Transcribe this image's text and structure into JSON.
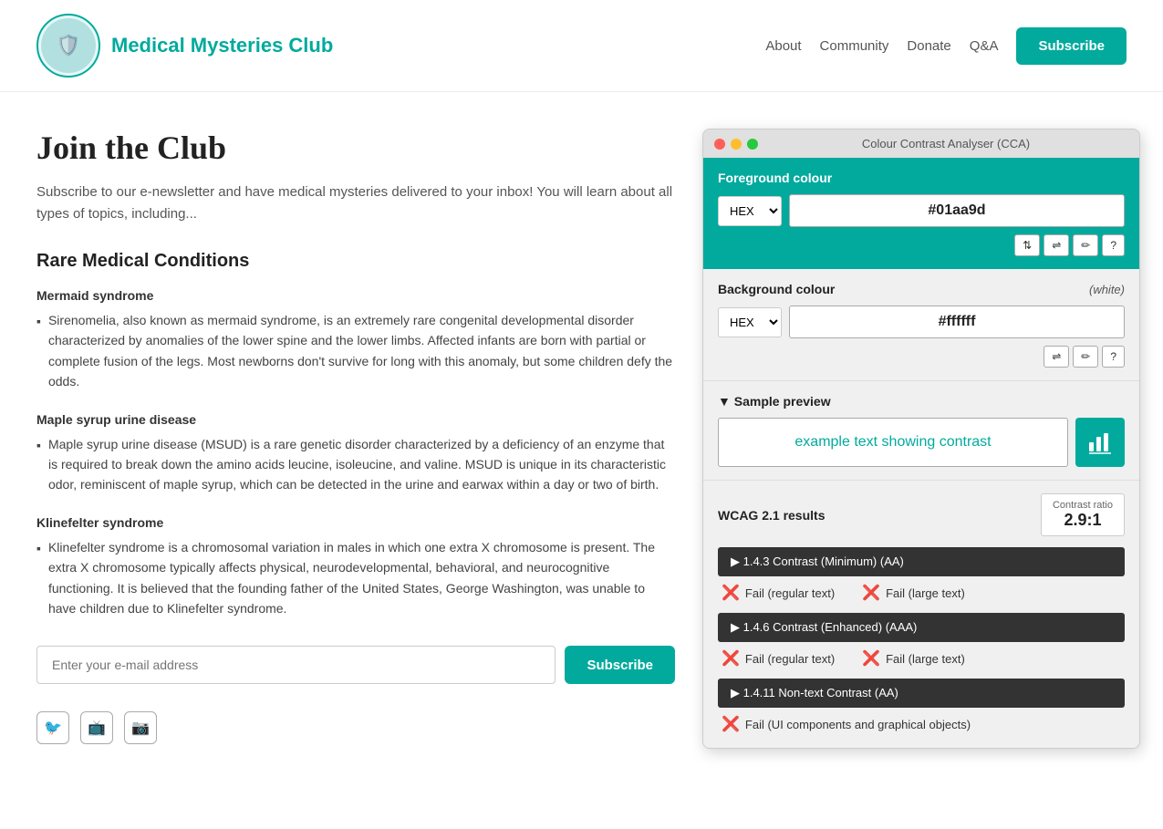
{
  "header": {
    "site_title": "Medical Mysteries Club",
    "logo_emoji": "🛡️",
    "nav": {
      "about": "About",
      "community": "Community",
      "donate": "Donate",
      "qa": "Q&A",
      "subscribe": "Subscribe"
    }
  },
  "main": {
    "page_title": "Join the Club",
    "subtitle": "Subscribe to our e-newsletter and have medical mysteries delivered to your inbox! You will learn about all types of topics, including...",
    "section_heading": "Rare Medical Conditions",
    "conditions": [
      {
        "title": "Mermaid syndrome",
        "description": "Sirenomelia, also known as mermaid syndrome, is an extremely rare congenital developmental disorder characterized by anomalies of the lower spine and the lower limbs. Affected infants are born with partial or complete fusion of the legs. Most newborns don't survive for long with this anomaly, but some children defy the odds."
      },
      {
        "title": "Maple syrup urine disease",
        "description": "Maple syrup urine disease (MSUD) is a rare genetic disorder characterized by a deficiency of an enzyme that is required to break down the amino acids leucine, isoleucine, and valine. MSUD is unique in its characteristic odor, reminiscent of maple syrup, which can be detected in the urine and earwax within a day or two of birth."
      },
      {
        "title": "Klinefelter syndrome",
        "description": "Klinefelter syndrome is a chromosomal variation in males in which one extra X chromosome is present. The extra X chromosome typically affects physical, neurodevelopmental, behavioral, and neurocognitive functioning. It is believed that the founding father of the United States, George Washington, was unable to have children due to Klinefelter syndrome."
      }
    ],
    "email_placeholder": "Enter your e-mail address",
    "subscribe_form_btn": "Subscribe",
    "social_icons": [
      "🐦",
      "📺",
      "📷"
    ]
  },
  "cca": {
    "window_title": "Colour Contrast Analyser (CCA)",
    "foreground_label": "Foreground colour",
    "fg_format": "HEX",
    "fg_value": "#01aa9d",
    "bg_label": "Background colour",
    "bg_white_note": "(white)",
    "bg_format": "HEX",
    "bg_value": "#ffffff",
    "preview_heading": "Sample preview",
    "preview_text": "example text showing contrast",
    "wcag_heading": "WCAG 2.1 results",
    "contrast_ratio_label": "Contrast ratio",
    "contrast_ratio_value": "2.9:1",
    "wcag_items": [
      {
        "id": "1_4_3",
        "label": "1.4.3 Contrast (Minimum) (AA)",
        "regular_text": "Fail (regular text)",
        "large_text": "Fail (large text)"
      },
      {
        "id": "1_4_6",
        "label": "1.4.6 Contrast (Enhanced) (AAA)",
        "regular_text": "Fail (regular text)",
        "large_text": "Fail (large text)"
      },
      {
        "id": "1_4_11",
        "label": "1.4.11 Non-text Contrast (AA)",
        "ui_components": "Fail (UI components and graphical objects)"
      }
    ],
    "tool_buttons": {
      "arrows": "⇅",
      "sliders": "⇌",
      "eyedropper": "✏",
      "help": "?"
    }
  }
}
